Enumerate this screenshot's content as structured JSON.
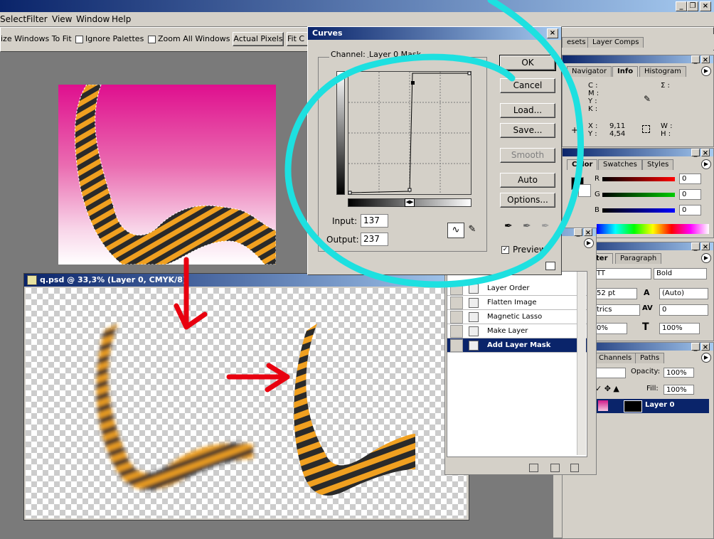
{
  "menubar": {
    "items": [
      "Select",
      "Filter",
      "View",
      "Window",
      "Help"
    ]
  },
  "options_bar": {
    "resize_windows_label": "ize Windows To Fit",
    "ignore_palettes_label": "Ignore Palettes",
    "zoom_all_label": "Zoom All Windows",
    "actual_pixels_label": "Actual Pixels",
    "fit_label": "Fit C"
  },
  "top_tabs": {
    "presets": "esets",
    "layer_comps": "Layer Comps"
  },
  "navigator": {
    "tabs": [
      "Navigator",
      "Info",
      "Histogram"
    ],
    "c": "C :",
    "m": "M :",
    "y": "Y :",
    "k": "K :",
    "sigma": "Σ :",
    "x_label": "X :",
    "x_value": "9,11",
    "y_label": "Y :",
    "y_value": "4,54",
    "w_label": "W :",
    "h_label": "H :"
  },
  "color": {
    "tabs": [
      "Color",
      "Swatches",
      "Styles"
    ],
    "r_label": "R",
    "r_value": "0",
    "g_label": "G",
    "g_value": "0",
    "b_label": "B",
    "b_value": "0",
    "colors": {
      "red": "#cc0000",
      "green": "#00aa00",
      "blue": "#0000cc"
    }
  },
  "character": {
    "tabs": [
      "ter",
      "Paragraph"
    ],
    "font_value": "TT",
    "style_value": "Bold",
    "size_value": "52 pt",
    "leading_value": "(Auto)",
    "kerning_value": "trics",
    "tracking_value": "0",
    "vscale_value": "0%",
    "hscale_value": "100%"
  },
  "layers": {
    "tabs": [
      "Channels",
      "Paths"
    ],
    "opacity_label": "Opacity:",
    "opacity_value": "100%",
    "fill_label": "Fill:",
    "fill_value": "100%",
    "layer_name": "Layer 0"
  },
  "history": {
    "items": [
      "Layer Order",
      "Flatten Image",
      "Magnetic Lasso",
      "Make Layer",
      "Add Layer Mask"
    ],
    "selected_index": 4
  },
  "curves": {
    "title": "Curves",
    "channel_label": "Channel:",
    "channel_value": "Layer 0 Mask",
    "input_label": "Input:",
    "input_value": "137",
    "output_label": "Output:",
    "output_value": "237",
    "buttons": {
      "ok": "OK",
      "cancel": "Cancel",
      "load": "Load...",
      "save": "Save...",
      "smooth": "Smooth",
      "auto": "Auto",
      "options": "Options..."
    },
    "preview_label": "Preview",
    "preview_checked": true
  },
  "document": {
    "title": "q.psd @ 33,3% (Layer 0, CMYK/8)"
  },
  "annotation_colors": {
    "circle": "#1de0e0",
    "arrows": "#e8000f"
  }
}
